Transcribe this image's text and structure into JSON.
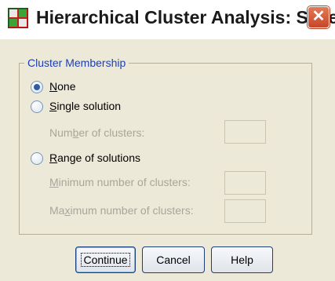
{
  "window": {
    "title": "Hierarchical Cluster Analysis: Save",
    "close_glyph": "✕",
    "app_icon": "spss-grid-icon"
  },
  "group": {
    "legend": "Cluster Membership",
    "none": {
      "prefix": "",
      "mnemonic": "N",
      "suffix": "one",
      "checked": true
    },
    "single": {
      "prefix": "",
      "mnemonic": "S",
      "suffix": "ingle solution",
      "checked": false
    },
    "num_clusters": {
      "prefix": "Num",
      "mnemonic": "b",
      "suffix": "er of clusters:",
      "value": ""
    },
    "range": {
      "prefix": "",
      "mnemonic": "R",
      "suffix": "ange of solutions",
      "checked": false
    },
    "min_clusters": {
      "prefix": "",
      "mnemonic": "M",
      "suffix": "inimum number of clusters:",
      "value": ""
    },
    "max_clusters": {
      "prefix": "Ma",
      "mnemonic": "x",
      "suffix": "imum number of clusters:",
      "value": ""
    }
  },
  "buttons": {
    "continue": "Continue",
    "cancel": "Cancel",
    "help": "Help"
  }
}
